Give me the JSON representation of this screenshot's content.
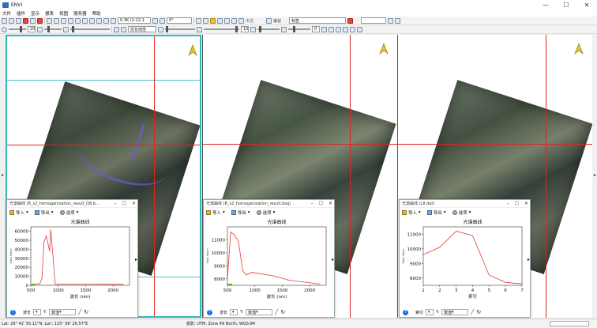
{
  "window": {
    "title": "ENVI",
    "min": "—",
    "max": "☐",
    "close": "✕"
  },
  "menu": [
    "文件",
    "插件",
    "显示",
    "报表",
    "视图",
    "服务器",
    "帮助"
  ],
  "toolbar1": {
    "zoom_value": "0.3K (1:12.1",
    "rotate_value": "0°",
    "layer_value": "未选",
    "band_value": "标签",
    "stretch_label": "无线",
    "mode_label": "追记"
  },
  "toolbar2": {
    "stretch_value": "优化线性",
    "value_20a": "20",
    "value_0": "0",
    "value_10": "10"
  },
  "views": [
    {
      "name": "view-1",
      "active": true
    },
    {
      "name": "view-2",
      "active": false
    },
    {
      "name": "view-3",
      "active": false
    }
  ],
  "spectra": [
    {
      "title": "光谱曲线 (B_s2_homogenization_result_Q8.b...",
      "import": "导入",
      "export": "导出",
      "options": "选项",
      "chart_title": "光谱曲线",
      "xlabel": "波长 (nm)",
      "foot_x": "波长",
      "foot_y": "数值",
      "ylabel_small": "Data Value"
    },
    {
      "title": "光谱曲线 (B_s2_homogenization_result.bsq)",
      "import": "导入",
      "export": "导出",
      "options": "选项",
      "chart_title": "光谱曲线",
      "xlabel": "波长 (nm)",
      "foot_x": "波长",
      "foot_y": "数值",
      "ylabel_small": "Data Value"
    },
    {
      "title": "光谱曲线 (L8.dat)",
      "import": "导入",
      "export": "导出",
      "options": "选项",
      "chart_title": "光谱曲线",
      "xlabel": "索引",
      "foot_x": "索引",
      "foot_y": "数值",
      "ylabel_small": "Data Value"
    }
  ],
  "chart_data": [
    {
      "type": "line",
      "title": "光谱曲线",
      "xlabel": "波长 (nm)",
      "xlim": [
        500,
        2300
      ],
      "ylim": [
        0,
        65000
      ],
      "xticks": [
        500,
        1000,
        1500,
        2000
      ],
      "yticks": [
        0,
        10000,
        20000,
        30000,
        40000,
        50000,
        60000
      ],
      "x": [
        443,
        490,
        560,
        665,
        705,
        740,
        783,
        842,
        865,
        945,
        1375,
        1610,
        2190
      ],
      "y": [
        500,
        800,
        1300,
        1800,
        8000,
        48000,
        55000,
        38000,
        62000,
        1500,
        1400,
        1300,
        1100
      ]
    },
    {
      "type": "line",
      "title": "光谱曲线",
      "xlabel": "波长 (nm)",
      "xlim": [
        500,
        2300
      ],
      "ylim": [
        7500,
        12000
      ],
      "xticks": [
        500,
        1000,
        1500,
        2000
      ],
      "yticks": [
        8000,
        9000,
        10000,
        11000
      ],
      "x": [
        443,
        560,
        620,
        700,
        780,
        842,
        945,
        1375,
        1610,
        2190
      ],
      "y": [
        8000,
        11600,
        11400,
        10900,
        8600,
        8300,
        8500,
        8200,
        7900,
        7600
      ],
      "y_note": ""
    },
    {
      "type": "line",
      "title": "光谱曲线",
      "xlabel": "索引",
      "xlim": [
        1,
        7
      ],
      "ylim": [
        7500,
        11500
      ],
      "xticks": [
        1,
        2,
        3,
        4,
        5,
        6,
        7
      ],
      "yticks": [
        8000,
        9000,
        10000,
        11000
      ],
      "x": [
        1,
        2,
        3,
        4,
        5,
        6,
        7
      ],
      "y": [
        9600,
        10100,
        11200,
        10900,
        8200,
        7700,
        7600
      ]
    }
  ],
  "status": {
    "latlon": "Lat: 29° 42' 55.11\"N, Lon: 115° 56' 26.57\"E",
    "proj": "投影: UTM, Zone 49 North, WGS-84"
  }
}
